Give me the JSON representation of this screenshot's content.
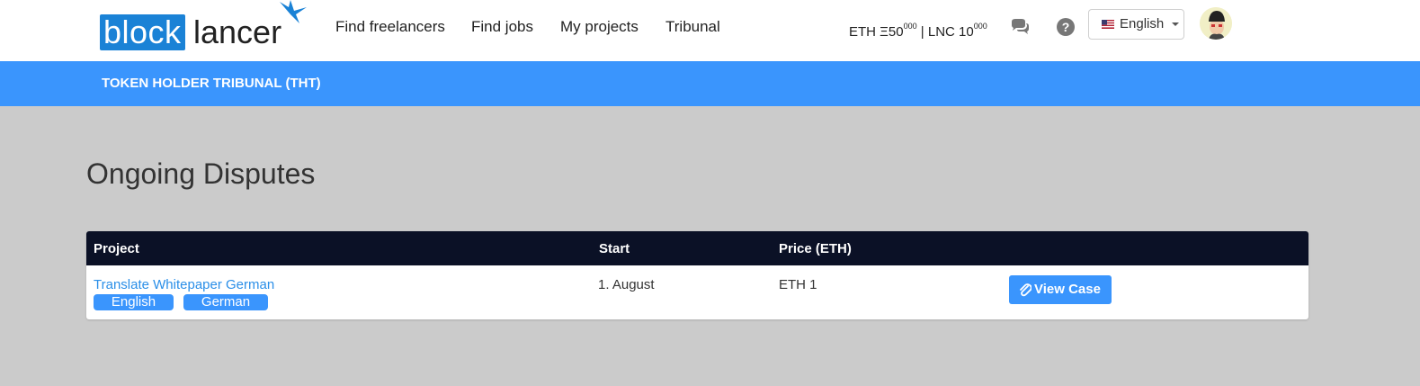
{
  "brand": {
    "logo_part1": "block",
    "logo_part2": "lancer",
    "logo_icon": "butterfly-icon",
    "colors": {
      "logo_blue": "#1a82d6",
      "accent": "#3a95fd",
      "table_header": "#0b1126",
      "link": "#2b8fe8"
    }
  },
  "nav": {
    "items": [
      {
        "label": "Find freelancers"
      },
      {
        "label": "Find jobs"
      },
      {
        "label": "My projects"
      },
      {
        "label": "Tribunal"
      }
    ]
  },
  "balance": {
    "eth_prefix": "ETH Ξ50",
    "eth_sup": "000",
    "separator": " | LNC 10",
    "lnc_sup": "000"
  },
  "header_icons": {
    "chat": "chat-icon",
    "help": "help-icon"
  },
  "language": {
    "selected": "English",
    "flag": "us-flag-icon"
  },
  "band": {
    "title": "TOKEN HOLDER TRIBUNAL (THT)"
  },
  "page": {
    "title": "Ongoing Disputes"
  },
  "table": {
    "columns": [
      "Project",
      "Start",
      "Price (ETH)"
    ],
    "rows": [
      {
        "project": "Translate Whitepaper German",
        "tags": [
          "English",
          "German"
        ],
        "start": "1. August",
        "price": "ETH 1",
        "action_label": "View Case",
        "action_icon": "paperclip-icon"
      }
    ]
  }
}
